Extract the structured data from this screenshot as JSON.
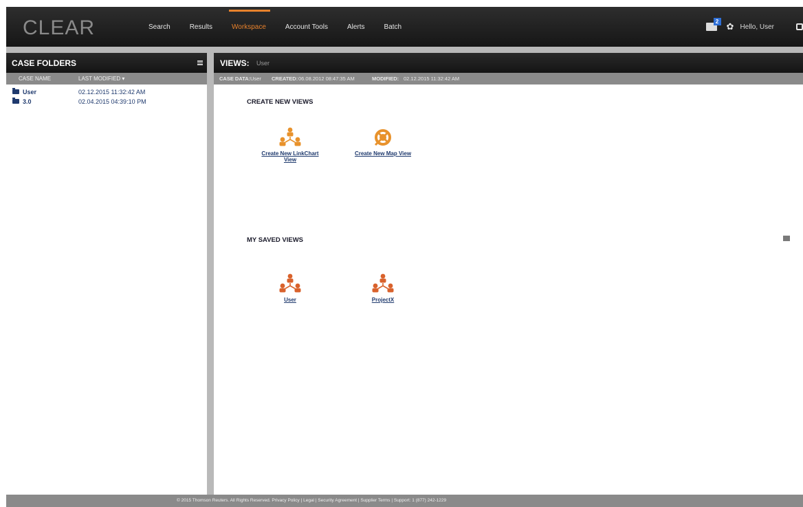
{
  "app": {
    "logo": "CLEAR"
  },
  "nav": {
    "items": [
      {
        "label": "Search"
      },
      {
        "label": "Results"
      },
      {
        "label": "Workspace"
      },
      {
        "label": "Account Tools"
      },
      {
        "label": "Alerts"
      },
      {
        "label": "Batch"
      }
    ],
    "active": "Workspace"
  },
  "user": {
    "greeting": "Hello, User",
    "message_count": "2"
  },
  "case_folders": {
    "title": "CASE FOLDERS",
    "columns": [
      "CASE NAME",
      "LAST MODIFIED ▾"
    ],
    "rows": [
      {
        "name": "User",
        "modified": "02.12.2015 11:32:42 AM"
      },
      {
        "name": "3.0",
        "modified": "02.04.2015 04:39:10 PM"
      }
    ]
  },
  "views": {
    "title": "VIEWS:",
    "subtitle": "User",
    "case_data_label": "CASE DATA:",
    "case_data_value": "User",
    "created_label": "CREATED:",
    "created_value": "06.08.2012 08:47:35 AM",
    "modified_label": "MODIFIED:",
    "modified_value": "02.12.2015 11:32:42 AM",
    "create_section": "CREATE NEW VIEWS",
    "create_items": [
      {
        "label": "Create New LinkChart View",
        "icon": "linkchart-icon"
      },
      {
        "label": "Create New Map View",
        "icon": "map-icon"
      }
    ],
    "saved_section": "MY SAVED VIEWS",
    "saved_items": [
      {
        "label": "User",
        "icon": "linkchart-icon"
      },
      {
        "label": "ProjectX",
        "icon": "linkchart-icon"
      }
    ]
  },
  "footer": {
    "text": "© 2015 Thomson Reuters. All Rights Reserved. Privacy Policy | Legal | Security Agreement | Supplier Terms | Support: 1 (877) 242-1229"
  },
  "colors": {
    "accent": "#e8822c",
    "link": "#1f3a6e",
    "header": "#1a1a1a"
  }
}
